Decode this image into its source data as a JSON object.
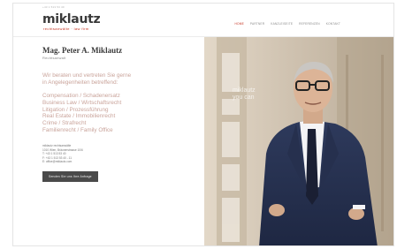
{
  "topbar": {
    "text": "+43 1 513 53 40"
  },
  "logo": {
    "main": "miklautz",
    "sub": "rechtsanwälte · law firm"
  },
  "nav": {
    "items": [
      "Home",
      "Partner",
      "Kanzleiseite",
      "Referenzen",
      "Kontakt"
    ],
    "active_index": 0
  },
  "profile": {
    "name": "Mag. Peter A. Miklautz",
    "role": "Rechtsanwalt"
  },
  "intro": {
    "line1": "Wir beraten und vertreten Sie gerne",
    "line2": "in Angelegenheiten betreffend:"
  },
  "areas": [
    "Compensation / Schadenersatz",
    "Business Law / Wirtschaftsrecht",
    "Litigation / Prozessführung",
    "Real Estate / Immobilienrecht",
    "Crime / Strafrecht",
    "Familienrecht / Family Office"
  ],
  "contact": {
    "firm": "miklautz rechtsanwälte",
    "address": "1010 Wien, Bräunerstrasse 10/6",
    "phone": "T: +43 1 513 53 40",
    "fax": "F: +43 1 513 53 40 - 11",
    "email": "E: office@miklautz.com"
  },
  "cta": {
    "label": "Senden Sie uns Ihre Anfrage"
  },
  "photo": {
    "overlay_line1": "miklautz",
    "overlay_line2": "you can"
  },
  "colors": {
    "accent": "#c4301e",
    "text_muted": "#c9a39a",
    "button_bg": "#4a4a4a"
  }
}
